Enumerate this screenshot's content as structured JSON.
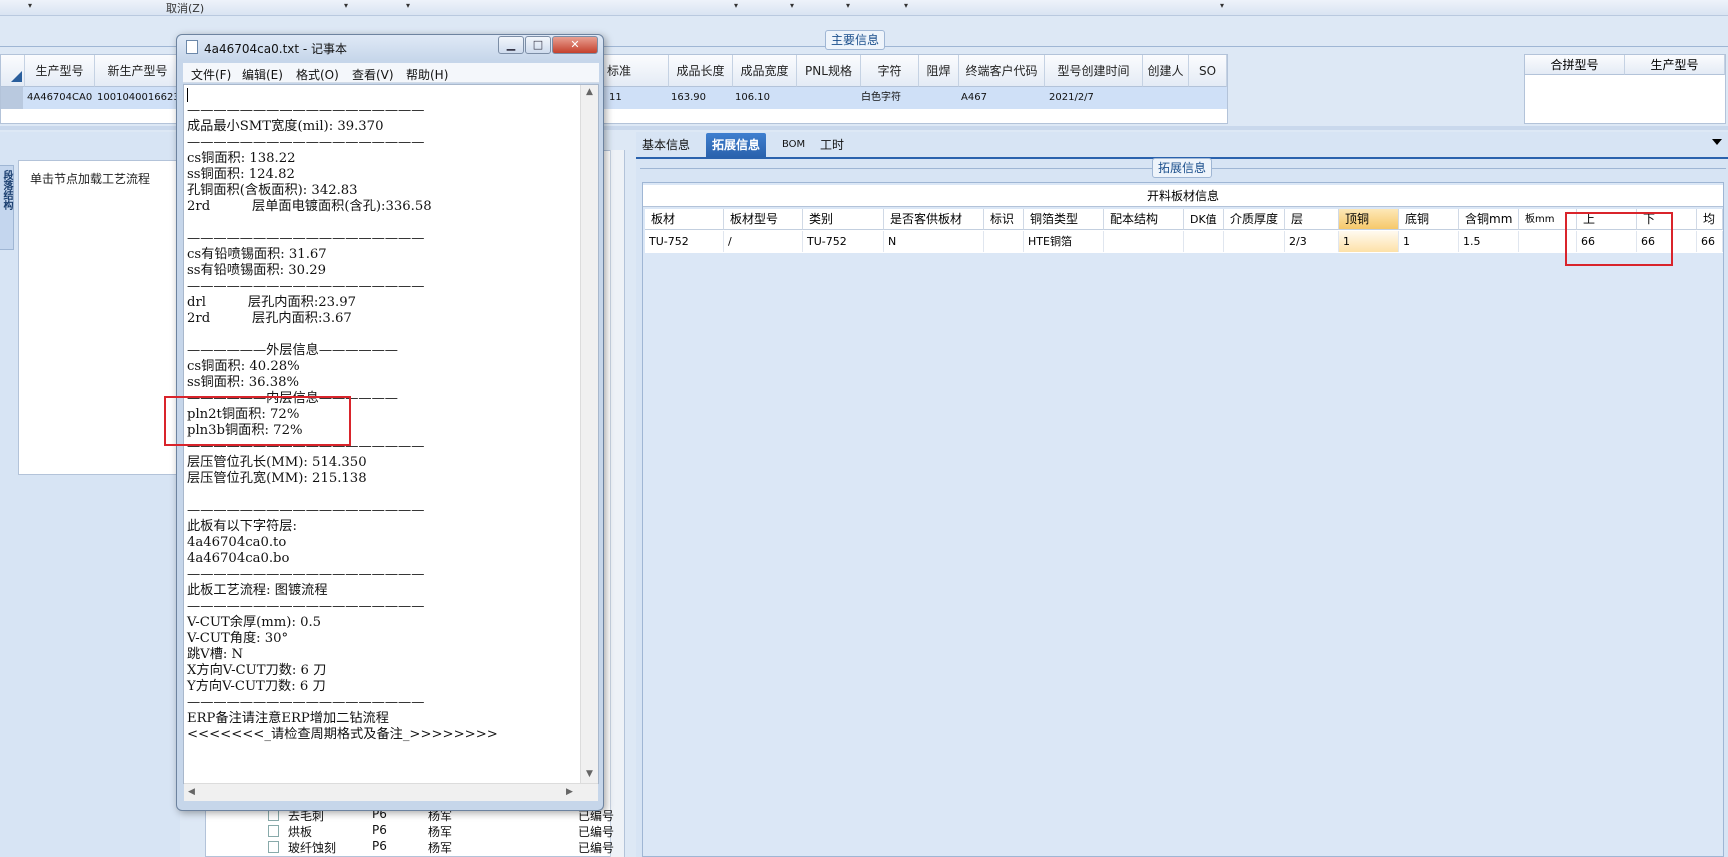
{
  "toolbar": {
    "cancel_label": "取消(Z)",
    "dropdown_glyph": "▾"
  },
  "main_info": {
    "title": "主要信息",
    "columns": [
      "生产型号",
      "新生产型号",
      "",
      "标准",
      "成品长度",
      "成品宽度",
      "PNL规格",
      "字符",
      "阻焊",
      "终端客户代码",
      "型号创建时间",
      "创建人",
      "SO"
    ],
    "row": {
      "prod_model": "4A46704CA0",
      "new_prod_model": "10010400166236",
      "standard": "11",
      "length": "163.90",
      "width": "106.10",
      "pnl": "",
      "char": "白色字符",
      "mask": "",
      "customer": "A467",
      "created": "2021/2/7",
      "creator": "",
      "so": ""
    }
  },
  "merge_grid": {
    "columns": [
      "合拼型号",
      "生产型号"
    ]
  },
  "left_panel": {
    "vertical_tab": "段落结构",
    "card_title": "单击节点加载工艺流程"
  },
  "tree": {
    "rows": [
      {
        "name": "去毛刺",
        "code": "P6",
        "person": "杨军",
        "status": "已编号"
      },
      {
        "name": "烘板",
        "code": "P6",
        "person": "杨军",
        "status": "已编号"
      },
      {
        "name": "玻纤蚀刻",
        "code": "P6",
        "person": "杨军",
        "status": "已编号"
      }
    ]
  },
  "right_tabs": [
    {
      "label": "基本信息"
    },
    {
      "label": "拓展信息",
      "active": true
    },
    {
      "label": "BOM"
    },
    {
      "label": "工时"
    }
  ],
  "expansion": {
    "title": "拓展信息",
    "material_title": "开料板材信息",
    "columns": [
      "板材",
      "板材型号",
      "类别",
      "是否客供板材",
      "标识",
      "铜箔类型",
      "配本结构",
      "DK值",
      "介质厚度",
      "层",
      "顶铜",
      "底铜",
      "含铜mm",
      "板mm",
      "上",
      "下",
      "均"
    ],
    "row": [
      "TU-752",
      "/",
      "TU-752",
      "N",
      "",
      "HTE铜箔",
      "",
      "",
      "",
      "2/3",
      "1",
      "1",
      "1.5",
      "",
      "66",
      "66",
      "66"
    ]
  },
  "notepad": {
    "title": "4a46704ca0.txt - 记事本",
    "menus": [
      "文件(F)",
      "编辑(E)",
      "格式(O)",
      "查看(V)",
      "帮助(H)"
    ],
    "buttons": {
      "minimize": "▁",
      "maximize": "□",
      "close": "✕"
    },
    "lines": [
      "——————————————————",
      "成品最小SMT宽度(mil): 39.370",
      "——————————————————",
      "cs铜面积: 138.22",
      "ss铜面积: 124.82",
      "孔铜面积(含板面积): 342.83",
      "2rd          层单面电镀面积(含孔):336.58",
      "",
      "——————————————————",
      "cs有铅喷锡面积: 31.67",
      "ss有铅喷锡面积: 30.29",
      "——————————————————",
      "drl          层孔内面积:23.97",
      "2rd          层孔内面积:3.67",
      "",
      "——————外层信息——————",
      "cs铜面积: 40.28%",
      "ss铜面积: 36.38%",
      "——————内层信息——————",
      "pln2t铜面积: 72%",
      "pln3b铜面积: 72%",
      "——————————————————",
      "层压管位孔长(MM): 514.350",
      "层压管位孔宽(MM): 215.138",
      "",
      "——————————————————",
      "此板有以下字符层:",
      "4a46704ca0.to",
      "4a46704ca0.bo",
      "——————————————————",
      "此板工艺流程: 图镀流程",
      "——————————————————",
      "V-CUT余厚(mm): 0.5",
      "V-CUT角度: 30°",
      "跳V槽: N",
      "X方向V-CUT刀数: 6 刀",
      "Y方向V-CUT刀数: 6 刀",
      "——————————————————",
      "ERP备注请注意ERP增加二钻流程",
      "<<<<<<<_请检查周期格式及备注_>>>>>>>>"
    ]
  },
  "colors": {
    "highlight": "#d9242b",
    "accent": "#2a62ad",
    "selected_row": "#cfe0f7"
  }
}
